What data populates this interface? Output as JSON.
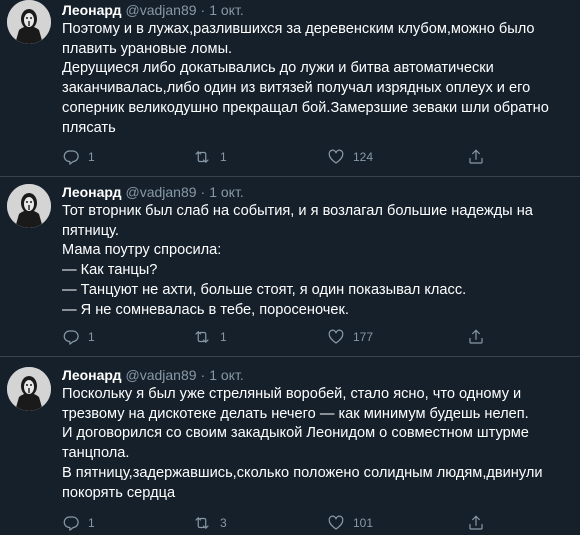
{
  "tweets": [
    {
      "name": "Леонард",
      "handle": "@vadjan89",
      "dot": "·",
      "date": "1 окт.",
      "lines": [
        "Поэтому и в лужах,разлившихся за деревенским клубом,можно было плавить урановые ломы.",
        "Дерущиеся либо докатывались до лужи и битва автоматически заканчивалась,либо один из витязей получал изрядных оплеух и его соперник великодушно прекращал бой.Замерзшие зеваки шли обратно плясать"
      ],
      "reply_count": "1",
      "retweet_count": "1",
      "like_count": "124"
    },
    {
      "name": "Леонард",
      "handle": "@vadjan89",
      "dot": "·",
      "date": "1 окт.",
      "lines": [
        "Тот вторник был слаб на события, и я возлагал большие надежды на пятницу.",
        "Мама поутру спросила:",
        "— Как танцы?",
        "— Танцуют не ахти, больше стоят, я один показывал класс.",
        "— Я не сомневалась в тебе, поросеночек."
      ],
      "reply_count": "1",
      "retweet_count": "1",
      "like_count": "177"
    },
    {
      "name": "Леонард",
      "handle": "@vadjan89",
      "dot": "·",
      "date": "1 окт.",
      "lines": [
        "Поскольку я был уже стреляный воробей, стало ясно, что одному и трезвому на дискотеке делать нечего — как минимум будешь нелеп.",
        "И договорился со своим закадыкой Леонидом о совместном штурме танцпола.",
        "В пятницу,задержавшись,сколько положено солидным людям,двинули покорять сердца"
      ],
      "reply_count": "1",
      "retweet_count": "3",
      "like_count": "101"
    }
  ],
  "icons": {
    "avatar": "masked-figure-avatar-icon",
    "reply": "reply-bubble-icon",
    "retweet": "retweet-arrows-icon",
    "like": "heart-icon",
    "share": "share-upload-icon"
  },
  "colors": {
    "background": "#15202b",
    "muted": "#8899a6",
    "divider": "#38444d"
  }
}
